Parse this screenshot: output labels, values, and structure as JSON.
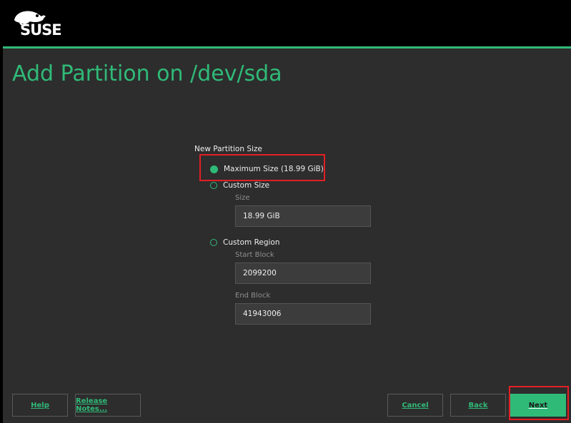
{
  "header": {
    "logo_text": "SUSE",
    "title": "Add Partition on /dev/sda"
  },
  "form": {
    "group_label": "New Partition Size",
    "options": [
      {
        "label": "Maximum Size (18.99 GiB)",
        "checked": true
      },
      {
        "label": "Custom Size",
        "checked": false
      },
      {
        "label": "Custom Region",
        "checked": false
      }
    ],
    "size": {
      "label": "Size",
      "value": "18.99 GiB"
    },
    "start_block": {
      "label": "Start Block",
      "value": "2099200"
    },
    "end_block": {
      "label": "End Block",
      "value": "41943006"
    }
  },
  "buttons": {
    "help": "Help",
    "release_notes": "Release Notes...",
    "cancel": "Cancel",
    "back": "Back",
    "next": "Next"
  },
  "colors": {
    "accent": "#30ba78",
    "background": "#2d2d2d",
    "highlight": "#e21f26"
  }
}
